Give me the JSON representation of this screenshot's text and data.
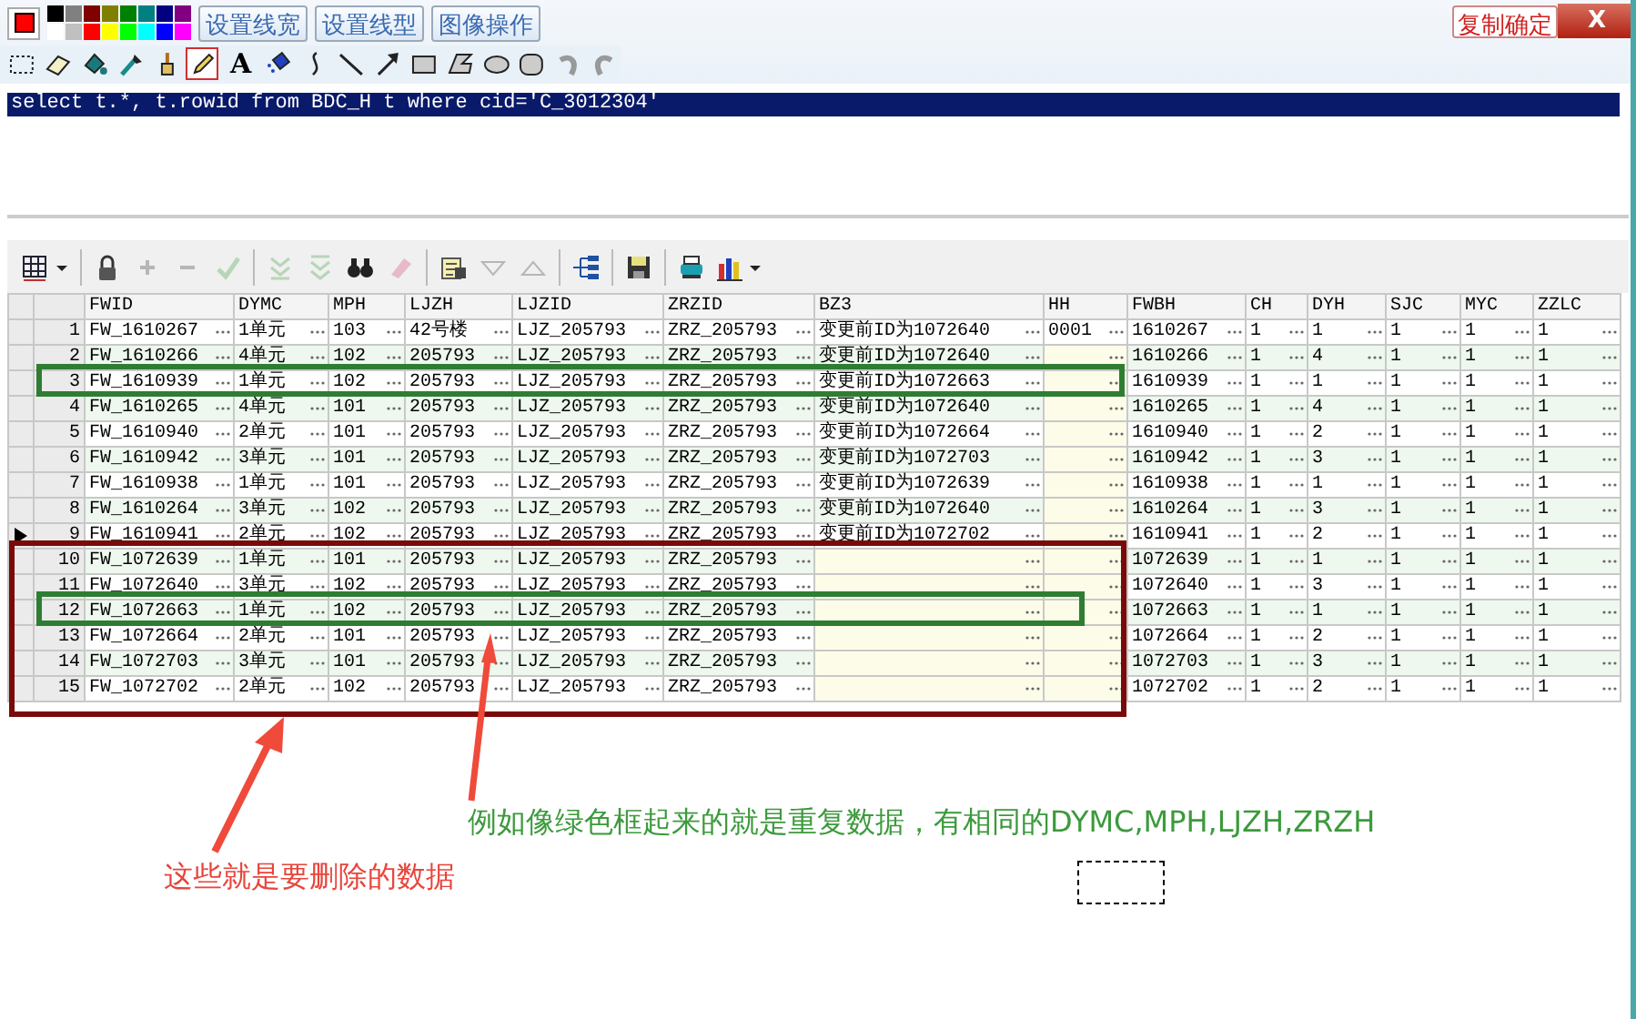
{
  "paint_toolbar": {
    "current_color": {
      "color": "#ff0000"
    },
    "palette": [
      {
        "color": "#000000"
      },
      {
        "color": "#808080"
      },
      {
        "color": "#800000"
      },
      {
        "color": "#808000"
      },
      {
        "color": "#008000"
      },
      {
        "color": "#008080"
      },
      {
        "color": "#000080"
      },
      {
        "color": "#800080"
      },
      {
        "color": "#ffffff"
      },
      {
        "color": "#c0c0c0"
      },
      {
        "color": "#ff0000"
      },
      {
        "color": "#ffff00"
      },
      {
        "color": "#00ff00"
      },
      {
        "color": "#00ffff"
      },
      {
        "color": "#0000ff"
      },
      {
        "color": "#ff00ff"
      }
    ],
    "buttons": [
      "设置线宽",
      "设置线型",
      "图像操作"
    ],
    "tools": [
      {
        "kind": "select",
        "selected": false
      },
      {
        "kind": "eraser",
        "selected": false
      },
      {
        "kind": "fill",
        "selected": false
      },
      {
        "kind": "picker",
        "selected": false
      },
      {
        "kind": "brush",
        "selected": false
      },
      {
        "kind": "pencil",
        "selected": true
      },
      {
        "kind": "text",
        "glyph": "A",
        "selected": false
      },
      {
        "kind": "spray",
        "selected": false
      },
      {
        "kind": "curve",
        "selected": false
      },
      {
        "kind": "line",
        "selected": false
      },
      {
        "kind": "arrow",
        "selected": false
      },
      {
        "kind": "rect",
        "selected": false
      },
      {
        "kind": "polygon",
        "selected": false
      },
      {
        "kind": "ellipse",
        "selected": false
      },
      {
        "kind": "roundrect",
        "selected": false
      },
      {
        "kind": "undo",
        "selected": false
      },
      {
        "kind": "redo",
        "selected": false
      }
    ],
    "confirm_button": "复制确定",
    "close_label": "X"
  },
  "sql_editor": {
    "text": "select t.*, t.rowid from BDC_H t where cid='C_3012304'"
  },
  "grid_toolbar": [
    {
      "kind": "grid",
      "disabled": false
    },
    {
      "kind": "sep"
    },
    {
      "kind": "lock",
      "disabled": false
    },
    {
      "kind": "add",
      "disabled": true
    },
    {
      "kind": "remove",
      "disabled": true
    },
    {
      "kind": "check",
      "disabled": true
    },
    {
      "kind": "sep"
    },
    {
      "kind": "next",
      "disabled": true
    },
    {
      "kind": "last",
      "disabled": true
    },
    {
      "kind": "find",
      "disabled": false
    },
    {
      "kind": "clear",
      "disabled": true
    },
    {
      "kind": "sep"
    },
    {
      "kind": "query",
      "disabled": false
    },
    {
      "kind": "down",
      "disabled": true
    },
    {
      "kind": "up",
      "disabled": true
    },
    {
      "kind": "sep"
    },
    {
      "kind": "tree",
      "disabled": false
    },
    {
      "kind": "sep"
    },
    {
      "kind": "save",
      "disabled": false
    },
    {
      "kind": "sep"
    },
    {
      "kind": "print",
      "disabled": false
    },
    {
      "kind": "chart",
      "disabled": false
    }
  ],
  "table": {
    "columns": [
      "FWID",
      "DYMC",
      "MPH",
      "LJZH",
      "LJZID",
      "ZRZID",
      "BZ3",
      "HH",
      "FWBH",
      "CH",
      "DYH",
      "SJC",
      "MYC",
      "ZZLC"
    ],
    "rows": [
      {
        "num": "1",
        "current": false,
        "cells": [
          "FW_1610267",
          "1单元",
          "103",
          "42号楼",
          "LJZ_205793",
          "ZRZ_205793",
          "变更前ID为1072640",
          "0001",
          "1610267",
          "1",
          "1",
          "1",
          "1",
          "1"
        ]
      },
      {
        "num": "2",
        "current": false,
        "cells": [
          "FW_1610266",
          "4单元",
          "102",
          "205793",
          "LJZ_205793",
          "ZRZ_205793",
          "变更前ID为1072640",
          "",
          "1610266",
          "1",
          "4",
          "1",
          "1",
          "1"
        ]
      },
      {
        "num": "3",
        "current": false,
        "cells": [
          "FW_1610939",
          "1单元",
          "102",
          "205793",
          "LJZ_205793",
          "ZRZ_205793",
          "变更前ID为1072663",
          "",
          "1610939",
          "1",
          "1",
          "1",
          "1",
          "1"
        ]
      },
      {
        "num": "4",
        "current": false,
        "cells": [
          "FW_1610265",
          "4单元",
          "101",
          "205793",
          "LJZ_205793",
          "ZRZ_205793",
          "变更前ID为1072640",
          "",
          "1610265",
          "1",
          "4",
          "1",
          "1",
          "1"
        ]
      },
      {
        "num": "5",
        "current": false,
        "cells": [
          "FW_1610940",
          "2单元",
          "101",
          "205793",
          "LJZ_205793",
          "ZRZ_205793",
          "变更前ID为1072664",
          "",
          "1610940",
          "1",
          "2",
          "1",
          "1",
          "1"
        ]
      },
      {
        "num": "6",
        "current": false,
        "cells": [
          "FW_1610942",
          "3单元",
          "101",
          "205793",
          "LJZ_205793",
          "ZRZ_205793",
          "变更前ID为1072703",
          "",
          "1610942",
          "1",
          "3",
          "1",
          "1",
          "1"
        ]
      },
      {
        "num": "7",
        "current": false,
        "cells": [
          "FW_1610938",
          "1单元",
          "101",
          "205793",
          "LJZ_205793",
          "ZRZ_205793",
          "变更前ID为1072639",
          "",
          "1610938",
          "1",
          "1",
          "1",
          "1",
          "1"
        ]
      },
      {
        "num": "8",
        "current": false,
        "cells": [
          "FW_1610264",
          "3单元",
          "102",
          "205793",
          "LJZ_205793",
          "ZRZ_205793",
          "变更前ID为1072640",
          "",
          "1610264",
          "1",
          "3",
          "1",
          "1",
          "1"
        ]
      },
      {
        "num": "9",
        "current": true,
        "cells": [
          "FW_1610941",
          "2单元",
          "102",
          "205793",
          "LJZ_205793",
          "ZRZ_205793",
          "变更前ID为1072702",
          "",
          "1610941",
          "1",
          "2",
          "1",
          "1",
          "1"
        ]
      },
      {
        "num": "10",
        "current": false,
        "cells": [
          "FW_1072639",
          "1单元",
          "101",
          "205793",
          "LJZ_205793",
          "ZRZ_205793",
          "",
          "",
          "1072639",
          "1",
          "1",
          "1",
          "1",
          "1"
        ]
      },
      {
        "num": "11",
        "current": false,
        "cells": [
          "FW_1072640",
          "3单元",
          "102",
          "205793",
          "LJZ_205793",
          "ZRZ_205793",
          "",
          "",
          "1072640",
          "1",
          "3",
          "1",
          "1",
          "1"
        ]
      },
      {
        "num": "12",
        "current": false,
        "cells": [
          "FW_1072663",
          "1单元",
          "102",
          "205793",
          "LJZ_205793",
          "ZRZ_205793",
          "",
          "",
          "1072663",
          "1",
          "1",
          "1",
          "1",
          "1"
        ]
      },
      {
        "num": "13",
        "current": false,
        "cells": [
          "FW_1072664",
          "2单元",
          "101",
          "205793",
          "LJZ_205793",
          "ZRZ_205793",
          "",
          "",
          "1072664",
          "1",
          "2",
          "1",
          "1",
          "1"
        ]
      },
      {
        "num": "14",
        "current": false,
        "cells": [
          "FW_1072703",
          "3单元",
          "101",
          "205793",
          "LJZ_205793",
          "ZRZ_205793",
          "",
          "",
          "1072703",
          "1",
          "3",
          "1",
          "1",
          "1"
        ]
      },
      {
        "num": "15",
        "current": false,
        "cells": [
          "FW_1072702",
          "2单元",
          "102",
          "205793",
          "LJZ_205793",
          "ZRZ_205793",
          "",
          "",
          "1072702",
          "1",
          "2",
          "1",
          "1",
          "1"
        ]
      }
    ]
  },
  "annotations": {
    "boxes": [
      {
        "color": "#2e7d32"
      },
      {
        "color": "#2e7d32"
      },
      {
        "color": "#7a0a0a"
      }
    ],
    "notes": [
      {
        "text": "例如像绿色框起来的就是重复数据，有相同的DYMC,MPH,LJZH,ZRZH",
        "color": "#3c9a3c"
      },
      {
        "text": "这些就是要删除的数据",
        "color": "#e8453c"
      }
    ]
  }
}
